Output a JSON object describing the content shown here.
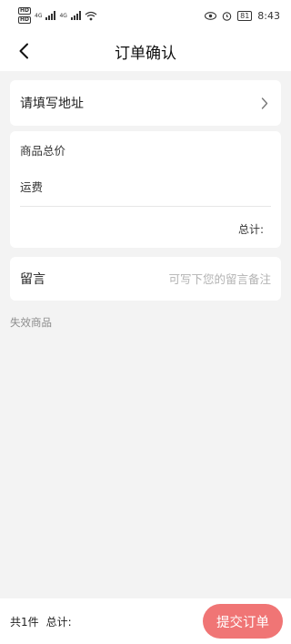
{
  "status_bar": {
    "hd1": "HD",
    "hd2": "HD",
    "net1": "4G",
    "net2": "4G",
    "battery": "81",
    "time": "8:43"
  },
  "nav": {
    "title": "订单确认"
  },
  "address": {
    "label": "请填写地址"
  },
  "price": {
    "goods_total_label": "商品总价",
    "shipping_label": "运费",
    "total_label": "总计:"
  },
  "message": {
    "label": "留言",
    "placeholder": "可写下您的留言备注"
  },
  "invalid": {
    "title": "失效商品"
  },
  "bottom": {
    "count_text": "共1件",
    "total_label": "总计:",
    "submit_label": "提交订单"
  },
  "colors": {
    "accent": "#f07575",
    "page_bg": "#f3f3f3"
  }
}
